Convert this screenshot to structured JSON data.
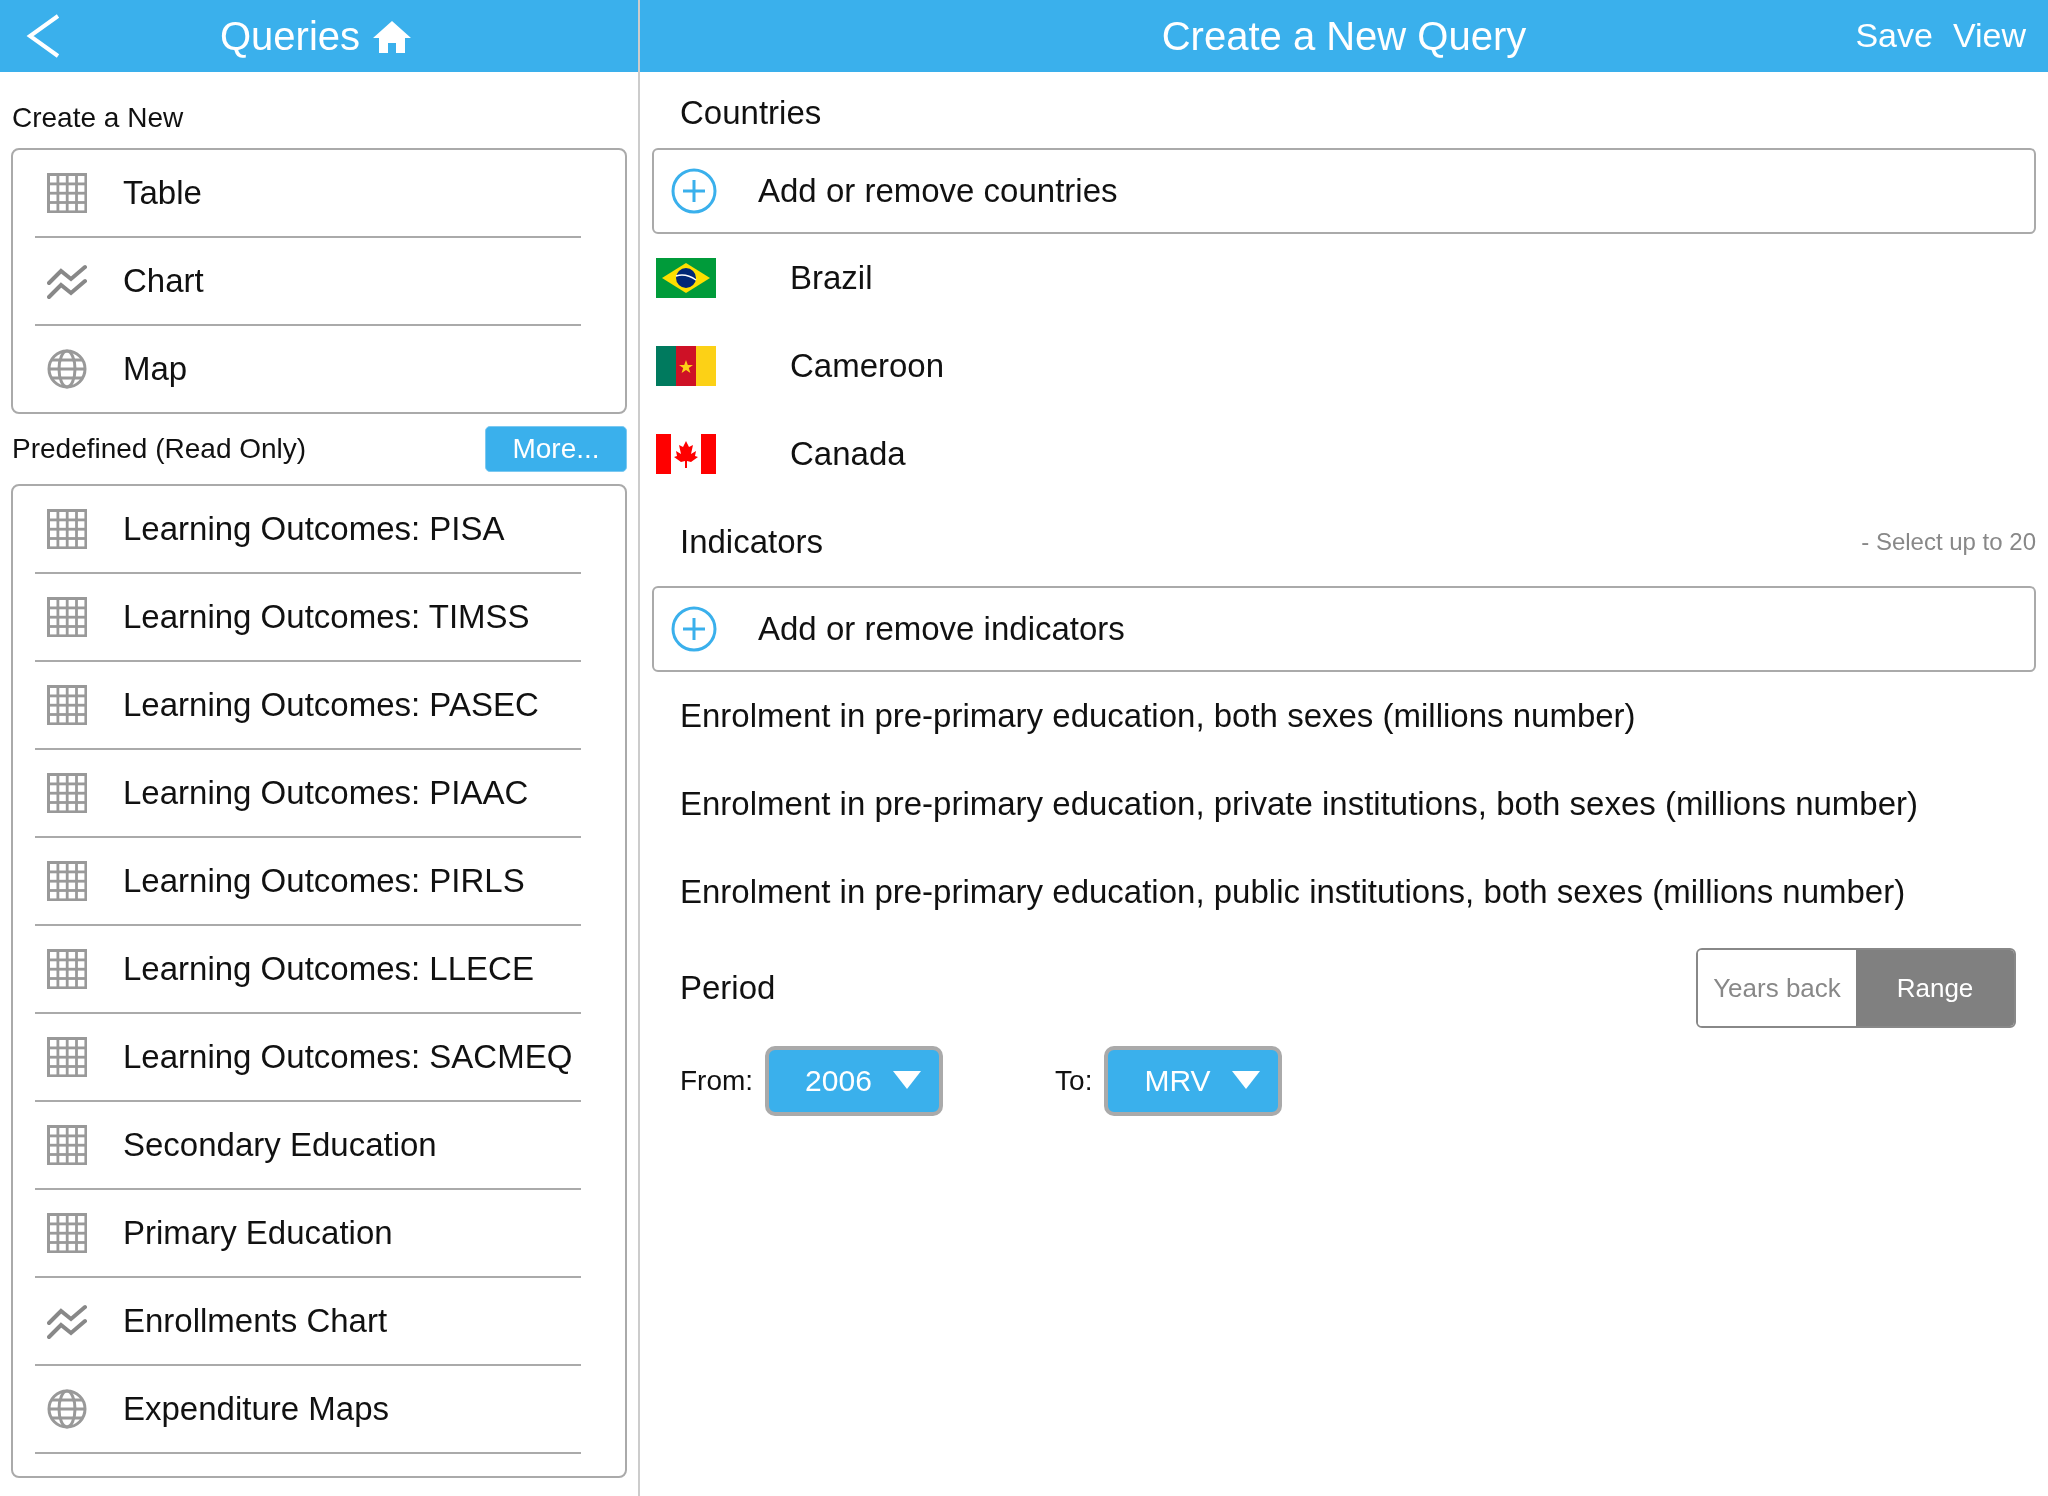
{
  "sidebar": {
    "title": "Queries",
    "create_label": "Create a New",
    "create_items": [
      {
        "label": "Table",
        "kind": "table"
      },
      {
        "label": "Chart",
        "kind": "chart"
      },
      {
        "label": "Map",
        "kind": "map"
      }
    ],
    "predefined_label": "Predefined (Read Only)",
    "more_button": "More...",
    "predefined_items": [
      {
        "label": "Learning Outcomes: PISA",
        "kind": "table"
      },
      {
        "label": "Learning Outcomes: TIMSS",
        "kind": "table"
      },
      {
        "label": "Learning Outcomes: PASEC",
        "kind": "table"
      },
      {
        "label": "Learning Outcomes: PIAAC",
        "kind": "table"
      },
      {
        "label": "Learning Outcomes: PIRLS",
        "kind": "table"
      },
      {
        "label": "Learning Outcomes: LLECE",
        "kind": "table"
      },
      {
        "label": "Learning Outcomes: SACMEQ",
        "kind": "table"
      },
      {
        "label": "Secondary Education",
        "kind": "table"
      },
      {
        "label": "Primary Education",
        "kind": "table"
      },
      {
        "label": "Enrollments Chart",
        "kind": "chart"
      },
      {
        "label": "Expenditure Maps",
        "kind": "map"
      }
    ]
  },
  "main": {
    "title": "Create a New Query",
    "actions": [
      "Save",
      "View"
    ],
    "countries_label": "Countries",
    "add_countries": "Add or remove countries",
    "countries": [
      {
        "name": "Brazil",
        "kind": "brazil"
      },
      {
        "name": "Cameroon",
        "kind": "cameroon"
      },
      {
        "name": "Canada",
        "kind": "canada"
      }
    ],
    "indicators_label": "Indicators",
    "indicators_hint": "- Select up to 20",
    "add_indicators": "Add or remove indicators",
    "indicators": [
      "Enrolment in pre-primary education, both sexes (millions number)",
      "Enrolment in pre-primary education, private institutions, both sexes (millions number)",
      "Enrolment in pre-primary education, public institutions, both sexes (millions number)"
    ],
    "period_label": "Period",
    "period_modes": [
      {
        "label": "Years back",
        "selected": false
      },
      {
        "label": "Range",
        "selected": true
      }
    ],
    "from_label": "From:",
    "from_value": "2006",
    "to_label": "To:",
    "to_value": "MRV"
  }
}
